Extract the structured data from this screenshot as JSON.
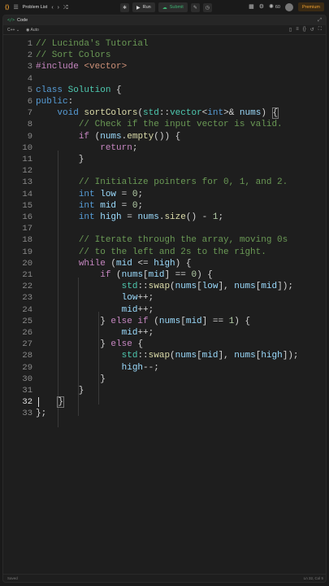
{
  "topbar": {
    "problem_list_label": "Problem List",
    "run_label": "Run",
    "submit_label": "Submit",
    "counter": "60",
    "premium_label": "Premium"
  },
  "panel": {
    "title": "Code",
    "language": "C++",
    "autocomplete": "Auto"
  },
  "status": {
    "left": "Saved",
    "right": "Ln 32, Col 5"
  },
  "editor": {
    "active_line": 32,
    "lines": [
      [
        [
          "cm",
          "// Lucinda's Tutorial"
        ]
      ],
      [
        [
          "cm",
          "// Sort Colors"
        ]
      ],
      [
        [
          "pp",
          "#include "
        ],
        [
          "str",
          "<vector>"
        ]
      ],
      [],
      [
        [
          "kw",
          "class "
        ],
        [
          "ty",
          "Solution"
        ],
        [
          "op",
          " {"
        ]
      ],
      [
        [
          "kw",
          "public"
        ],
        [
          "op",
          ":"
        ]
      ],
      [
        [
          "op",
          "    "
        ],
        [
          "kw",
          "void "
        ],
        [
          "fn",
          "sortColors"
        ],
        [
          "op",
          "("
        ],
        [
          "ns",
          "std"
        ],
        [
          "op",
          "::"
        ],
        [
          "ty",
          "vector"
        ],
        [
          "op",
          "<"
        ],
        [
          "kw",
          "int"
        ],
        [
          "op",
          ">& "
        ],
        [
          "var",
          "nums"
        ],
        [
          "op",
          ") "
        ],
        [
          "brk",
          "{"
        ]
      ],
      [
        [
          "op",
          "        "
        ],
        [
          "cm",
          "// Check if the input vector is valid."
        ]
      ],
      [
        [
          "op",
          "        "
        ],
        [
          "ctl",
          "if "
        ],
        [
          "op",
          "("
        ],
        [
          "var",
          "nums"
        ],
        [
          "op",
          "."
        ],
        [
          "fn",
          "empty"
        ],
        [
          "op",
          "()) {"
        ]
      ],
      [
        [
          "op",
          "            "
        ],
        [
          "ctl",
          "return"
        ],
        [
          "op",
          ";"
        ]
      ],
      [
        [
          "op",
          "        }"
        ]
      ],
      [],
      [
        [
          "op",
          "        "
        ],
        [
          "cm",
          "// Initialize pointers for 0, 1, and 2."
        ]
      ],
      [
        [
          "op",
          "        "
        ],
        [
          "kw",
          "int "
        ],
        [
          "var",
          "low"
        ],
        [
          "op",
          " = "
        ],
        [
          "num",
          "0"
        ],
        [
          "op",
          ";"
        ]
      ],
      [
        [
          "op",
          "        "
        ],
        [
          "kw",
          "int "
        ],
        [
          "var",
          "mid"
        ],
        [
          "op",
          " = "
        ],
        [
          "num",
          "0"
        ],
        [
          "op",
          ";"
        ]
      ],
      [
        [
          "op",
          "        "
        ],
        [
          "kw",
          "int "
        ],
        [
          "var",
          "high"
        ],
        [
          "op",
          " = "
        ],
        [
          "var",
          "nums"
        ],
        [
          "op",
          "."
        ],
        [
          "fn",
          "size"
        ],
        [
          "op",
          "() - "
        ],
        [
          "num",
          "1"
        ],
        [
          "op",
          ";"
        ]
      ],
      [],
      [
        [
          "op",
          "        "
        ],
        [
          "cm",
          "// Iterate through the array, moving 0s"
        ]
      ],
      [
        [
          "op",
          "        "
        ],
        [
          "cm",
          "// to the left and 2s to the right."
        ]
      ],
      [
        [
          "op",
          "        "
        ],
        [
          "ctl",
          "while "
        ],
        [
          "op",
          "("
        ],
        [
          "var",
          "mid"
        ],
        [
          "op",
          " <= "
        ],
        [
          "var",
          "high"
        ],
        [
          "op",
          ") {"
        ]
      ],
      [
        [
          "op",
          "            "
        ],
        [
          "ctl",
          "if "
        ],
        [
          "op",
          "("
        ],
        [
          "var",
          "nums"
        ],
        [
          "op",
          "["
        ],
        [
          "var",
          "mid"
        ],
        [
          "op",
          "] == "
        ],
        [
          "num",
          "0"
        ],
        [
          "op",
          ") {"
        ]
      ],
      [
        [
          "op",
          "                "
        ],
        [
          "ns",
          "std"
        ],
        [
          "op",
          "::"
        ],
        [
          "fn",
          "swap"
        ],
        [
          "op",
          "("
        ],
        [
          "var",
          "nums"
        ],
        [
          "op",
          "["
        ],
        [
          "var",
          "low"
        ],
        [
          "op",
          "], "
        ],
        [
          "var",
          "nums"
        ],
        [
          "op",
          "["
        ],
        [
          "var",
          "mid"
        ],
        [
          "op",
          "]);"
        ]
      ],
      [
        [
          "op",
          "                "
        ],
        [
          "var",
          "low"
        ],
        [
          "op",
          "++;"
        ]
      ],
      [
        [
          "op",
          "                "
        ],
        [
          "var",
          "mid"
        ],
        [
          "op",
          "++;"
        ]
      ],
      [
        [
          "op",
          "            } "
        ],
        [
          "ctl",
          "else if "
        ],
        [
          "op",
          "("
        ],
        [
          "var",
          "nums"
        ],
        [
          "op",
          "["
        ],
        [
          "var",
          "mid"
        ],
        [
          "op",
          "] == "
        ],
        [
          "num",
          "1"
        ],
        [
          "op",
          ") {"
        ]
      ],
      [
        [
          "op",
          "                "
        ],
        [
          "var",
          "mid"
        ],
        [
          "op",
          "++;"
        ]
      ],
      [
        [
          "op",
          "            } "
        ],
        [
          "ctl",
          "else "
        ],
        [
          "op",
          "{"
        ]
      ],
      [
        [
          "op",
          "                "
        ],
        [
          "ns",
          "std"
        ],
        [
          "op",
          "::"
        ],
        [
          "fn",
          "swap"
        ],
        [
          "op",
          "("
        ],
        [
          "var",
          "nums"
        ],
        [
          "op",
          "["
        ],
        [
          "var",
          "mid"
        ],
        [
          "op",
          "], "
        ],
        [
          "var",
          "nums"
        ],
        [
          "op",
          "["
        ],
        [
          "var",
          "high"
        ],
        [
          "op",
          "]);"
        ]
      ],
      [
        [
          "op",
          "                "
        ],
        [
          "var",
          "high"
        ],
        [
          "op",
          "--;"
        ]
      ],
      [
        [
          "op",
          "            }"
        ]
      ],
      [
        [
          "op",
          "        }"
        ]
      ],
      [
        [
          "op",
          "    "
        ],
        [
          "brk",
          "}"
        ]
      ],
      [
        [
          "op",
          "};"
        ]
      ]
    ]
  }
}
